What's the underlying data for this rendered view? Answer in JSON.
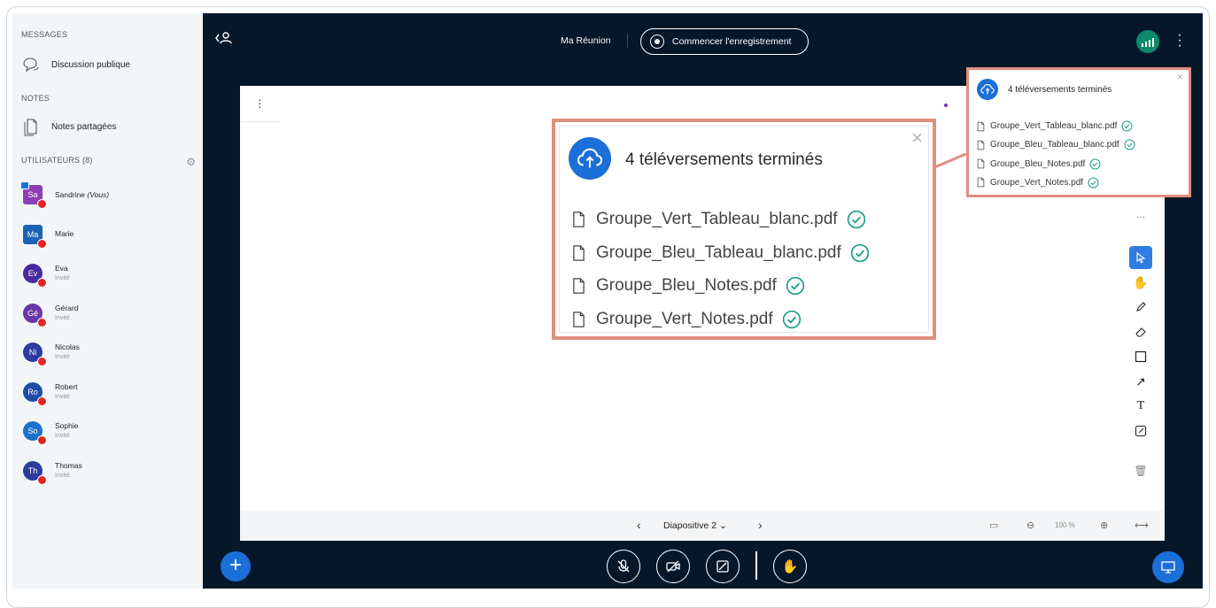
{
  "sidebar": {
    "messages_title": "MESSAGES",
    "public_chat": "Discussion publique",
    "notes_title": "NOTES",
    "shared_notes": "Notes partagées",
    "users_title": "UTILISATEURS (8)",
    "users": [
      {
        "initials": "Sa",
        "name": "Sandrine",
        "suffix": "(Vous)",
        "role": "",
        "color": "#8e3fb5",
        "shape": "square"
      },
      {
        "initials": "Ma",
        "name": "Marie",
        "suffix": "",
        "role": "",
        "color": "#1a63b5",
        "shape": "square"
      },
      {
        "initials": "Ev",
        "name": "Eva",
        "suffix": "",
        "role": "Invité",
        "color": "#4a2aa0",
        "shape": "round"
      },
      {
        "initials": "Gé",
        "name": "Gérard",
        "suffix": "",
        "role": "Invité",
        "color": "#6a36a8",
        "shape": "round"
      },
      {
        "initials": "Ni",
        "name": "Nicolas",
        "suffix": "",
        "role": "Invité",
        "color": "#2d3aa0",
        "shape": "round"
      },
      {
        "initials": "Ro",
        "name": "Robert",
        "suffix": "",
        "role": "Invité",
        "color": "#1e4da8",
        "shape": "round"
      },
      {
        "initials": "So",
        "name": "Sophie",
        "suffix": "",
        "role": "Invité",
        "color": "#1a72c8",
        "shape": "round"
      },
      {
        "initials": "Th",
        "name": "Thomas",
        "suffix": "",
        "role": "Invité",
        "color": "#2b3c9c",
        "shape": "round"
      }
    ]
  },
  "topbar": {
    "meeting_title": "Ma Réunion",
    "record_label": "Commencer l'enregistrement"
  },
  "slide": {
    "current_label": "Diapositive 2",
    "zoom": "100 %"
  },
  "upload": {
    "title": "4 téléversements terminés",
    "files": [
      "Groupe_Vert_Tableau_blanc.pdf",
      "Groupe_Bleu_Tableau_blanc.pdf",
      "Groupe_Bleu_Notes.pdf",
      "Groupe_Vert_Notes.pdf"
    ]
  },
  "colors": {
    "accent": "#1b6fd8",
    "highlight_border": "#e08e7d",
    "background": "#06172a",
    "mic_muted": "#df2721"
  }
}
